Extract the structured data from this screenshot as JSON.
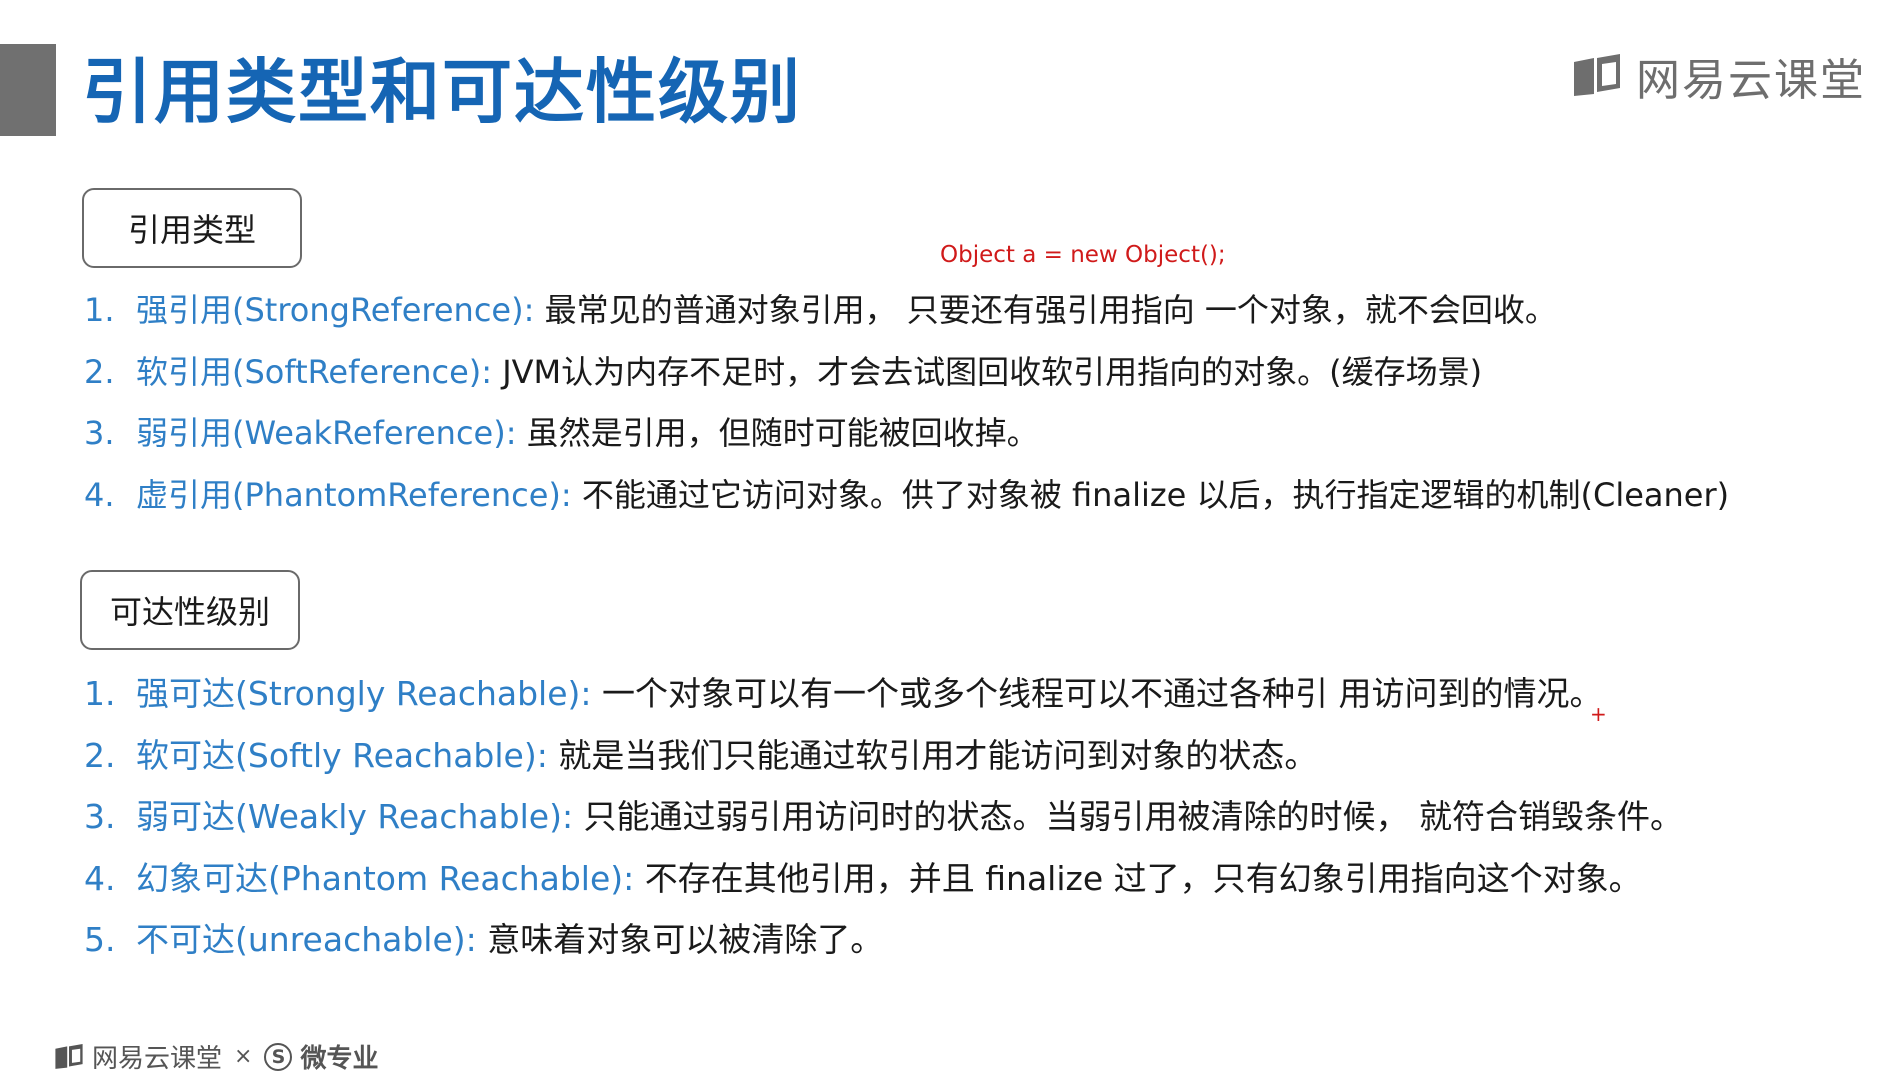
{
  "header": {
    "title": "引用类型和可达性级别",
    "brand": "网易云课堂"
  },
  "annotation": {
    "code": "Object a = new Object();",
    "plus": "+"
  },
  "sections": {
    "reference_types": {
      "label": "引用类型",
      "items": [
        {
          "num": "1.",
          "term": "强引用(StrongReference):",
          "desc": " 最常见的普通对象引用， 只要还有强引用指向 一个对象，就不会回收。"
        },
        {
          "num": "2.",
          "term": "软引用(SoftReference):",
          "desc": " JVM认为内存不足时，才会去试图回收软引用指向的对象。(缓存场景)"
        },
        {
          "num": "3.",
          "term": "弱引用(WeakReference):",
          "desc": " 虽然是引用，但随时可能被回收掉。"
        },
        {
          "num": "4.",
          "term": "虚引用(PhantomReference):",
          "desc": " 不能通过它访问对象。供了对象被 finalize 以后，执行指定逻辑的机制(Cleaner)"
        }
      ]
    },
    "reachability": {
      "label": "可达性级别",
      "items": [
        {
          "num": "1.",
          "term": "强可达(Strongly Reachable):",
          "desc": " 一个对象可以有一个或多个线程可以不通过各种引 用访问到的情况。"
        },
        {
          "num": "2.",
          "term": "软可达(Softly Reachable):",
          "desc": " 就是当我们只能通过软引用才能访问到对象的状态。"
        },
        {
          "num": "3.",
          "term": "弱可达(Weakly Reachable):",
          "desc": " 只能通过弱引用访问时的状态。当弱引用被清除的时候， 就符合销毁条件。"
        },
        {
          "num": "4.",
          "term": "幻象可达(Phantom Reachable):",
          "desc": " 不存在其他引用，并且 finalize 过了，只有幻象引用指向这个对象。"
        },
        {
          "num": "5.",
          "term": "不可达(unreachable):",
          "desc": " 意味着对象可以被清除了。"
        }
      ]
    }
  },
  "footer": {
    "brand": "网易云课堂",
    "times": "×",
    "s_badge": "S",
    "micro": "微专业"
  },
  "colors": {
    "title_blue": "#1565b4",
    "term_blue": "#2f7fc6",
    "annotation_red": "#d01a1a",
    "gray_bar": "#707070"
  },
  "icons": {
    "brand_top": "book-logo-icon",
    "brand_bottom": "book-logo-icon"
  }
}
